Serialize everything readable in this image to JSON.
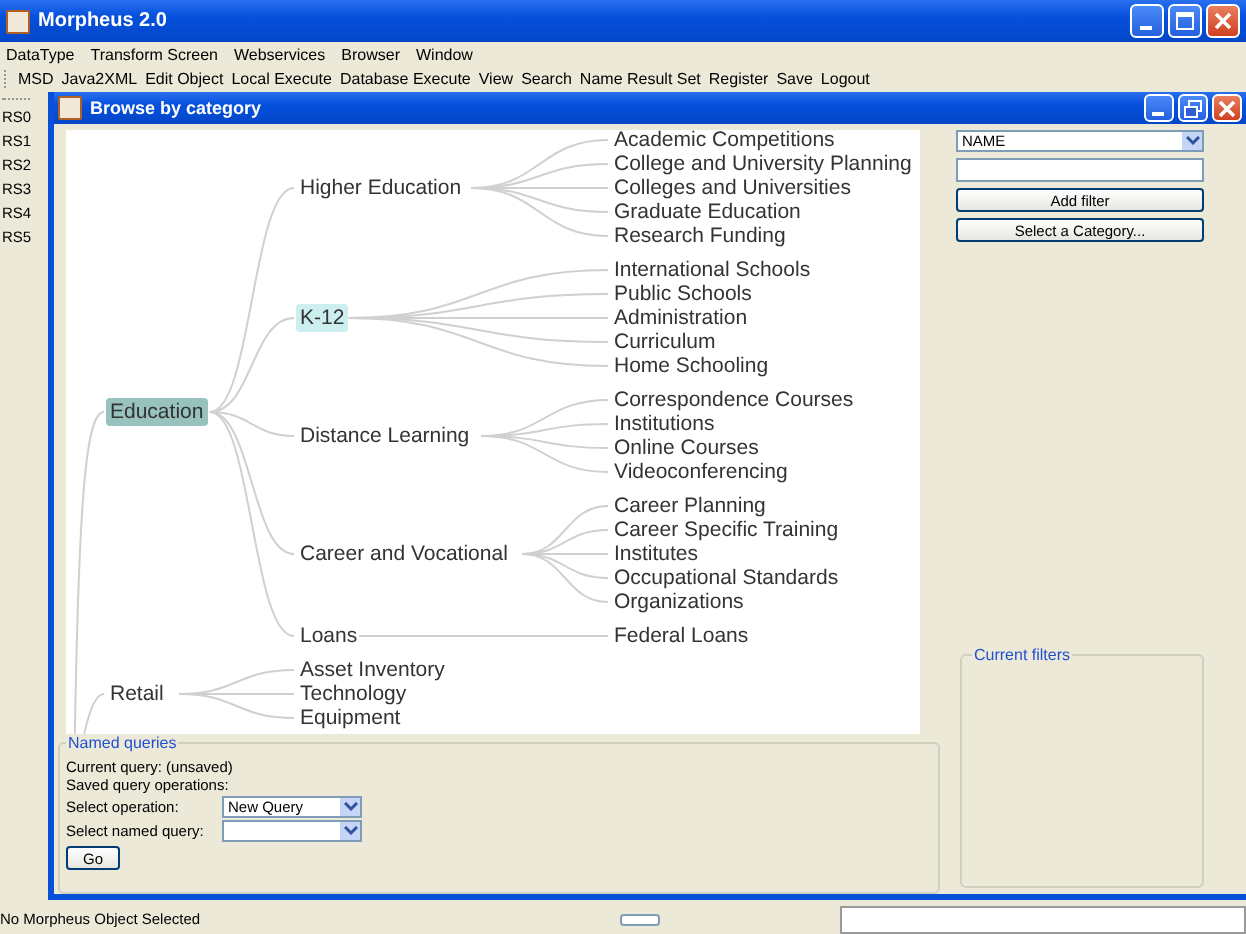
{
  "window": {
    "title": "Morpheus 2.0"
  },
  "menu": [
    "DataType",
    "Transform Screen",
    "Webservices",
    "Browser",
    "Window"
  ],
  "toolbar": [
    "MSD",
    "Java2XML",
    "Edit Object",
    "Local Execute",
    "Database Execute",
    "View",
    "Search",
    "Name Result Set",
    "Register",
    "Save",
    "Logout"
  ],
  "result_sets": [
    "RS0",
    "RS1",
    "RS2",
    "RS3",
    "RS4",
    "RS5"
  ],
  "browse_window": {
    "title": "Browse by category",
    "tree": [
      {
        "label": "Education",
        "selected": true,
        "hovered": false,
        "children": [
          {
            "label": "Higher Education",
            "selected": false,
            "hovered": false,
            "children": [
              {
                "label": "Academic Competitions",
                "selected": false,
                "hovered": false
              },
              {
                "label": "College and University Planning",
                "selected": false,
                "hovered": false
              },
              {
                "label": "Colleges and Universities",
                "selected": false,
                "hovered": false
              },
              {
                "label": "Graduate Education",
                "selected": false,
                "hovered": false
              },
              {
                "label": "Research Funding",
                "selected": false,
                "hovered": false
              }
            ]
          },
          {
            "label": "K-12",
            "selected": false,
            "hovered": true,
            "children": [
              {
                "label": "International Schools",
                "selected": false,
                "hovered": false
              },
              {
                "label": "Public Schools",
                "selected": false,
                "hovered": false
              },
              {
                "label": "Administration",
                "selected": false,
                "hovered": false
              },
              {
                "label": "Curriculum",
                "selected": false,
                "hovered": false
              },
              {
                "label": "Home Schooling",
                "selected": false,
                "hovered": false
              }
            ]
          },
          {
            "label": "Distance Learning",
            "selected": false,
            "hovered": false,
            "children": [
              {
                "label": "Correspondence Courses",
                "selected": false,
                "hovered": false
              },
              {
                "label": "Institutions",
                "selected": false,
                "hovered": false
              },
              {
                "label": "Online Courses",
                "selected": false,
                "hovered": false
              },
              {
                "label": "Videoconferencing",
                "selected": false,
                "hovered": false
              }
            ]
          },
          {
            "label": "Career and Vocational",
            "selected": false,
            "hovered": false,
            "children": [
              {
                "label": "Career Planning",
                "selected": false,
                "hovered": false
              },
              {
                "label": "Career Specific Training",
                "selected": false,
                "hovered": false
              },
              {
                "label": "Institutes",
                "selected": false,
                "hovered": false
              },
              {
                "label": "Occupational Standards",
                "selected": false,
                "hovered": false
              },
              {
                "label": "Organizations",
                "selected": false,
                "hovered": false
              }
            ]
          },
          {
            "label": "Loans",
            "selected": false,
            "hovered": false,
            "children": [
              {
                "label": "Federal Loans",
                "selected": false,
                "hovered": false
              }
            ]
          }
        ]
      },
      {
        "label": "Retail",
        "selected": false,
        "hovered": false,
        "children": [
          {
            "label": "Asset Inventory",
            "selected": false,
            "hovered": false
          },
          {
            "label": "Technology",
            "selected": false,
            "hovered": false
          },
          {
            "label": "Equipment",
            "selected": false,
            "hovered": false
          }
        ]
      }
    ],
    "filter": {
      "field_select": "NAME",
      "add_filter_button": "Add filter",
      "select_category_button": "Select a Category..."
    },
    "current_filters": {
      "title": "Current filters"
    },
    "named_queries": {
      "title": "Named queries",
      "current_query": "Current query: (unsaved)",
      "saved_label": "Saved query operations:",
      "operation_label": "Select operation:",
      "operation_value": "New Query",
      "named_query_label": "Select named query:",
      "go_button": "Go"
    }
  },
  "status_bar": {
    "message": "No Morpheus Object Selected"
  }
}
